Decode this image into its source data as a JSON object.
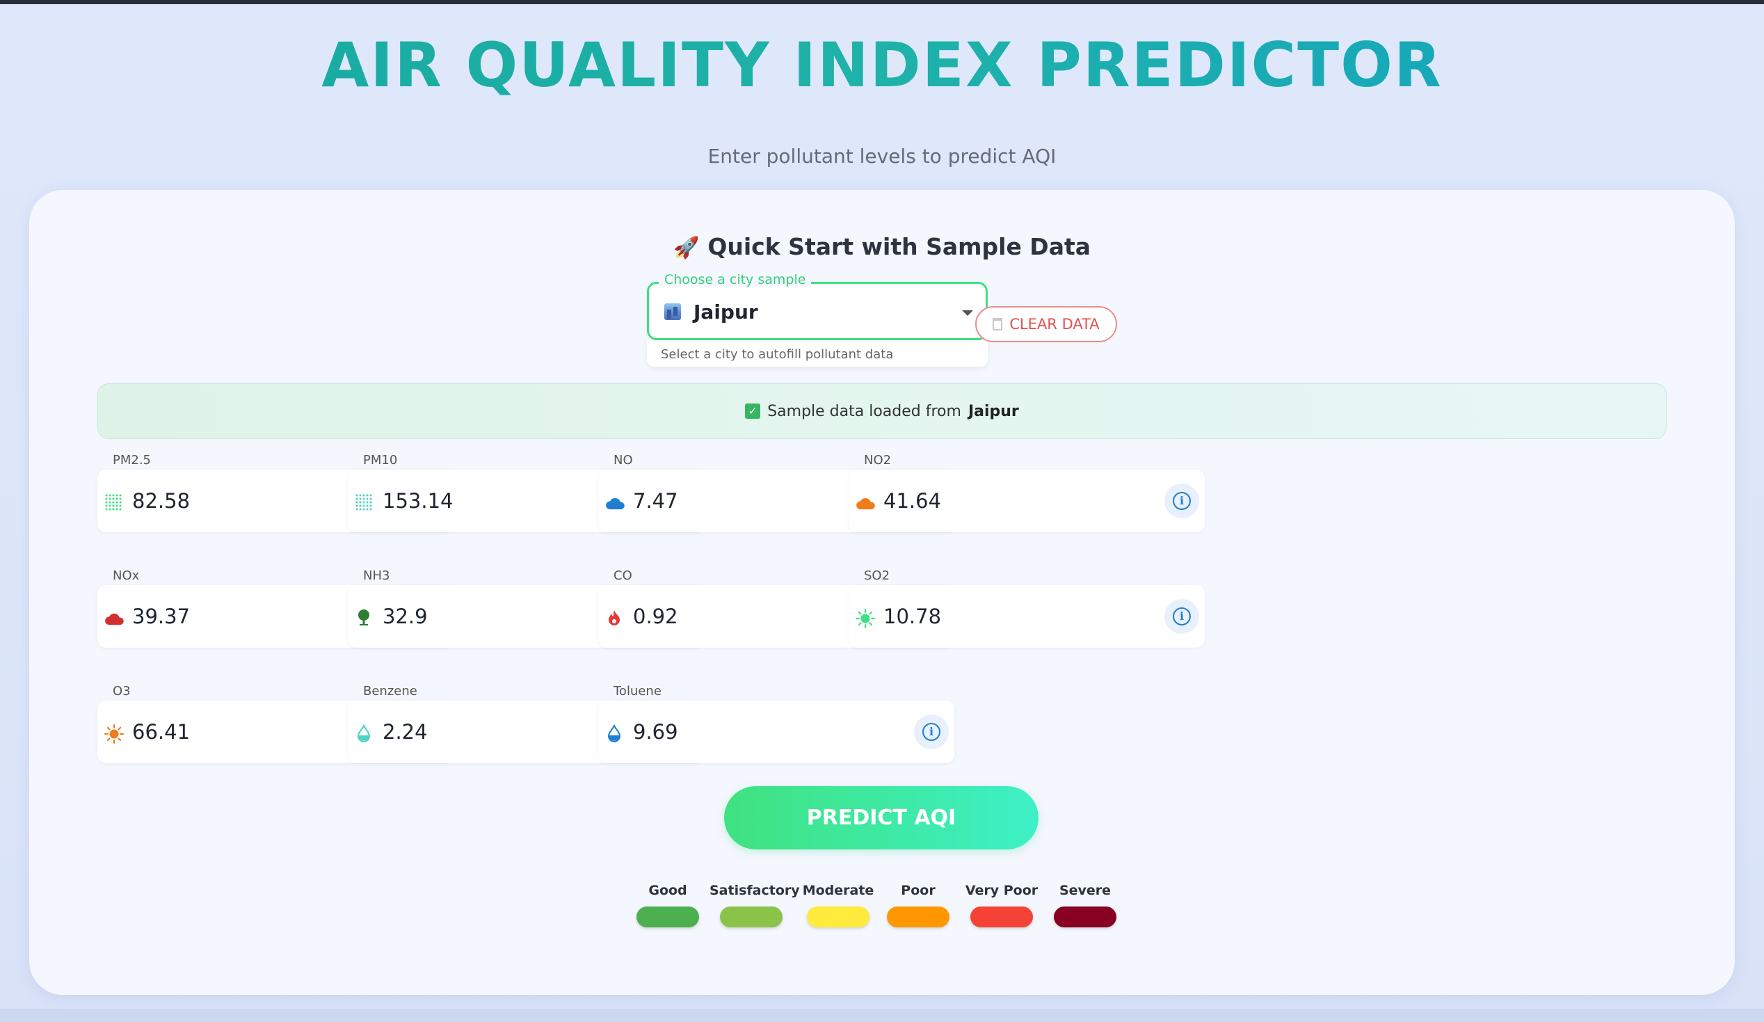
{
  "page": {
    "title": "AIR QUALITY INDEX PREDICTOR",
    "subtitle": "Enter pollutant levels to predict AQI"
  },
  "quick_start": {
    "title": "Quick Start with Sample Data",
    "icon": "rocket-icon",
    "select_label": "Choose a city sample",
    "selected_city": "Jaipur",
    "helper_text": "Select a city to autofill pollutant data",
    "clear_label": "CLEAR DATA"
  },
  "alert": {
    "prefix": "Sample data loaded from",
    "city": "Jaipur"
  },
  "pollutants": [
    {
      "label": "PM2.5",
      "value": "82.58",
      "icon": "dots-grid-icon",
      "color": "#3ee07f"
    },
    {
      "label": "PM10",
      "value": "153.14",
      "icon": "dots-grid-icon",
      "color": "#4fd1c5"
    },
    {
      "label": "NO",
      "value": "7.47",
      "icon": "cloud-icon",
      "color": "#1e7fd1"
    },
    {
      "label": "NO2",
      "value": "41.64",
      "icon": "cloud-icon",
      "color": "#f07c1a"
    },
    {
      "label": "NOx",
      "value": "39.37",
      "icon": "cloud-icon",
      "color": "#d32f2f"
    },
    {
      "label": "NH3",
      "value": "32.9",
      "icon": "tree-icon",
      "color": "#2e7d32"
    },
    {
      "label": "CO",
      "value": "0.92",
      "icon": "flame-icon",
      "color": "#e53935"
    },
    {
      "label": "SO2",
      "value": "10.78",
      "icon": "sun-icon",
      "color": "#3ee07f"
    },
    {
      "label": "O3",
      "value": "66.41",
      "icon": "sun-icon",
      "color": "#f07c1a"
    },
    {
      "label": "Benzene",
      "value": "2.24",
      "icon": "drop-icon",
      "color": "#4fd1c5"
    },
    {
      "label": "Toluene",
      "value": "9.69",
      "icon": "drop-icon",
      "color": "#1e7fd1"
    }
  ],
  "predict_label": "PREDICT AQI",
  "legend": [
    {
      "label": "Good",
      "color": "#4caf50"
    },
    {
      "label": "Satisfactory",
      "color": "#8bc34a"
    },
    {
      "label": "Moderate",
      "color": "#ffeb3b"
    },
    {
      "label": "Poor",
      "color": "#ff9800"
    },
    {
      "label": "Very Poor",
      "color": "#f44336"
    },
    {
      "label": "Severe",
      "color": "#880022"
    }
  ]
}
